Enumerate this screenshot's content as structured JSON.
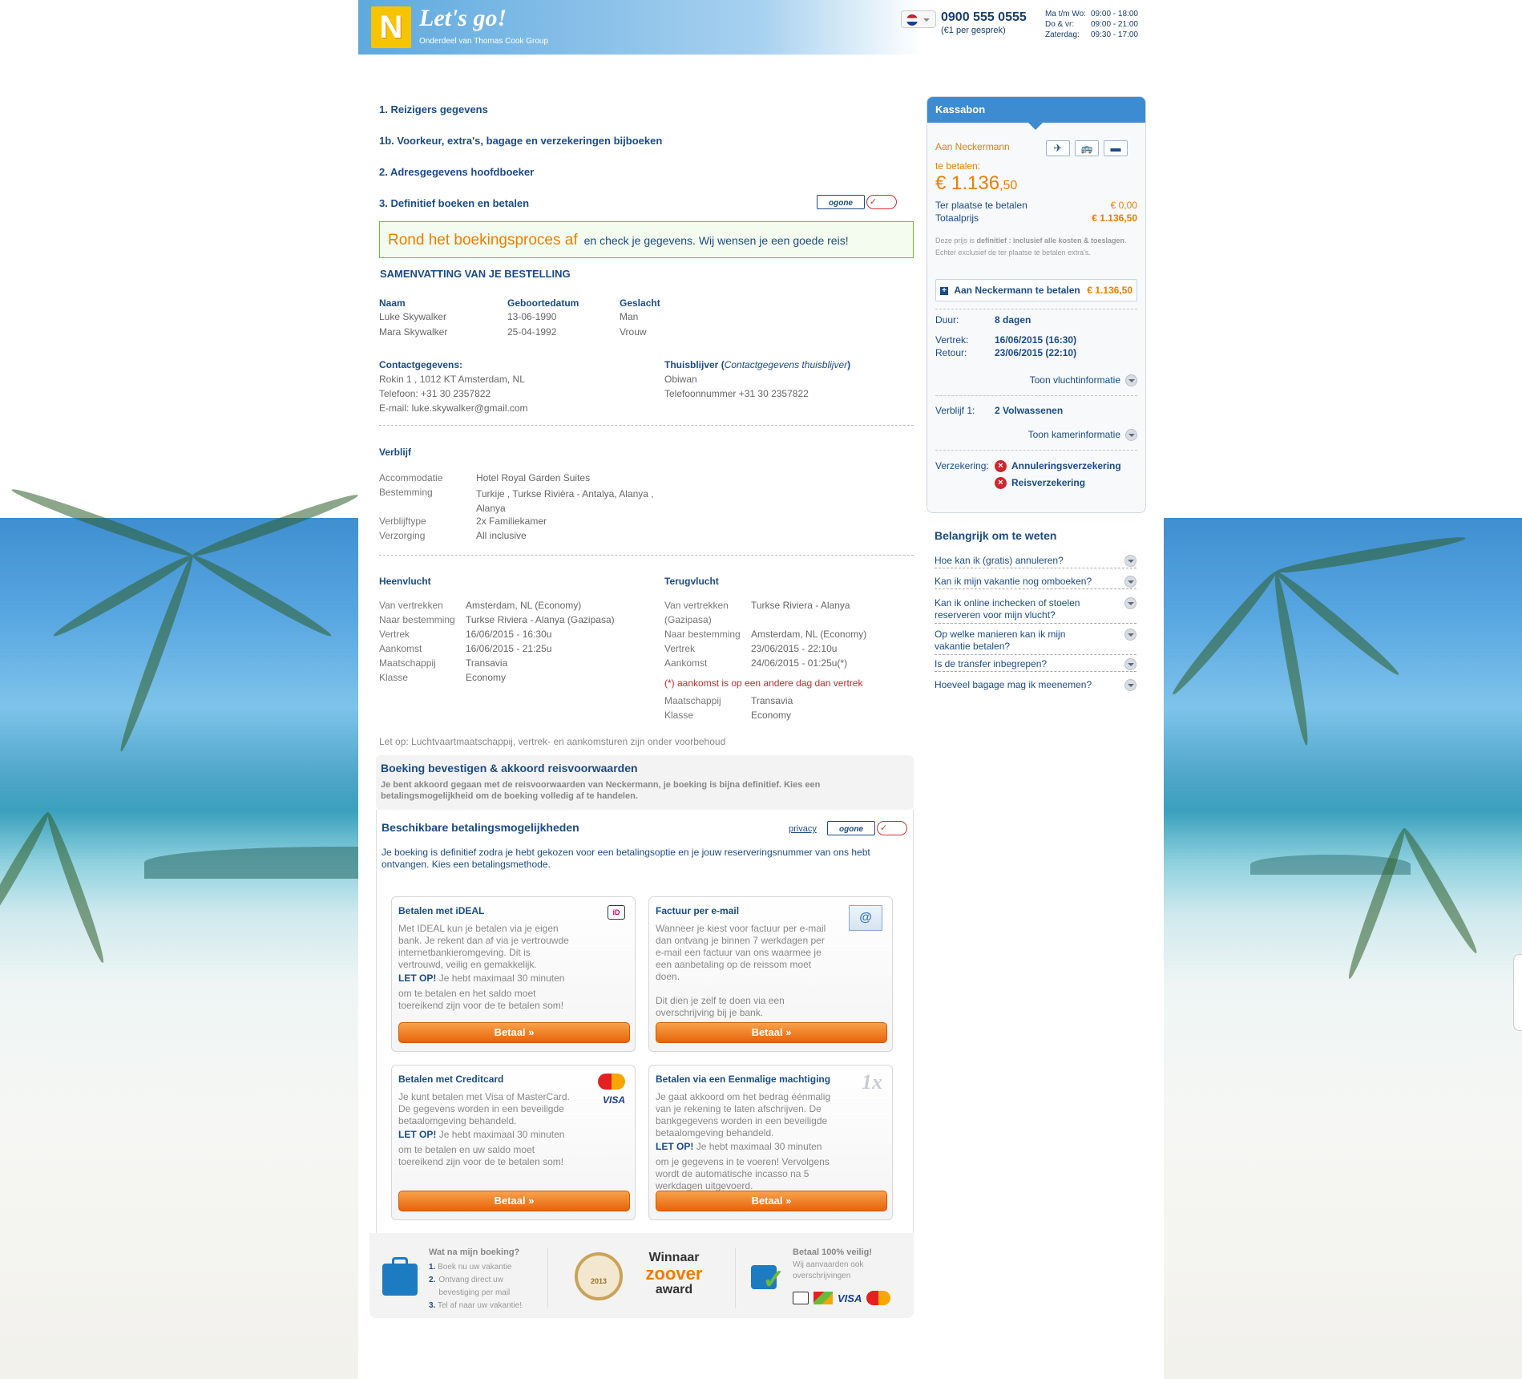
{
  "header": {
    "logo_brand": "Neckermann",
    "tagline": "Let's go!",
    "subtitle": "Onderdeel van Thomas Cook Group",
    "phone": "0900 555 0555",
    "phone_cost": "(€1 per gesprek)",
    "hours": [
      {
        "days": "Ma t/m Wo:",
        "time": "09:00 - 18:00"
      },
      {
        "days": "Do & vr:",
        "time": "09:00 - 21:00"
      },
      {
        "days": "Zaterdag:",
        "time": "09:30 - 17:00"
      }
    ]
  },
  "steps": [
    "1. Reizigers gegevens",
    "1b. Voorkeur, extra's, bagage en verzekeringen bijboeken",
    "2. Adresgegevens hoofdboeker",
    "3. Definitief boeken en betalen"
  ],
  "ogone_label": "ogone",
  "banner": {
    "big": "Rond het boekingsproces af",
    "small": "en check je gegevens. Wij wensen je een goede reis!"
  },
  "summary_title": "SAMENVATTING VAN JE BESTELLING",
  "travellers": {
    "headers": [
      "Naam",
      "Geboortedatum",
      "Geslacht"
    ],
    "rows": [
      [
        "Luke Skywalker",
        "13-06-1990",
        "Man"
      ],
      [
        "Mara Skywalker",
        "25-04-1992",
        "Vrouw"
      ]
    ]
  },
  "contact": {
    "title": "Contactgegevens:",
    "address": "Rokin 1 , 1012 KT Amsterdam, NL",
    "phone": "Telefoon: +31 30 2357822",
    "email": "E-mail: luke.skywalker@gmail.com"
  },
  "home": {
    "title": "Thuisblijver",
    "title_note": "Contactgegevens thuisblijver",
    "name": "Obiwan",
    "phone": "Telefoonnummer +31 30 2357822"
  },
  "stay": {
    "title": "Verblijf",
    "rows": [
      {
        "label": "Accommodatie",
        "value": "Hotel Royal Garden Suites"
      },
      {
        "label": "Bestemming",
        "value": "Turkije , Turkse Rivièra - Antalya, Alanya , Alanya"
      },
      {
        "label": "Verblijftype",
        "value": "2x Familiekamer"
      },
      {
        "label": "Verzorging",
        "value": "All inclusive"
      }
    ]
  },
  "outbound": {
    "title": "Heenvlucht",
    "rows": [
      {
        "label": "Van vertrekken",
        "value": "Amsterdam, NL (Economy)"
      },
      {
        "label": "Naar bestemming",
        "value": "Turkse Riviera - Alanya (Gazipasa)"
      },
      {
        "label": "Vertrek",
        "value": "16/06/2015 - 16:30u"
      },
      {
        "label": "Aankomst",
        "value": "16/06/2015 - 21:25u"
      },
      {
        "label": "Maatschappij",
        "value": "Transavia"
      },
      {
        "label": "Klasse",
        "value": "Economy"
      }
    ]
  },
  "return": {
    "title": "Terugvlucht",
    "rows": [
      {
        "label": "Van vertrekken",
        "value": "Turkse Riviera - Alanya"
      },
      {
        "label": "(Gazipasa)",
        "value": ""
      },
      {
        "label": "Naar bestemming",
        "value": "Amsterdam, NL (Economy)"
      },
      {
        "label": "Vertrek",
        "value": "23/06/2015 - 22:10u"
      },
      {
        "label": "Aankomst",
        "value": "24/06/2015 - 01:25u(*)"
      }
    ],
    "note": "(*) aankomst is op een andere dag dan vertrek",
    "rows2": [
      {
        "label": "Maatschappij",
        "value": "Transavia"
      },
      {
        "label": "Klasse",
        "value": "Economy"
      }
    ]
  },
  "flight_note": "Let op: Luchtvaartmaatschappij, vertrek- en aankomsturen zijn onder voorbehoud",
  "confirm": {
    "title": "Boeking bevestigen & akkoord reisvoorwaarden",
    "text": "Je bent akkoord gegaan met de reisvoorwaarden van Neckermann, je boeking is bijna definitief. Kies een betalingsmogelijkheid om de boeking volledig af te handelen."
  },
  "payment": {
    "title": "Beschikbare betalingsmogelijkheden",
    "privacy": "privacy",
    "intro": "Je boeking is definitief zodra je hebt gekozen voor een betalingsoptie en je jouw reserveringsnummer van ons hebt ontvangen. Kies een betalingsmethode.",
    "button": "Betaal »",
    "methods": [
      {
        "title": "Betalen met iDEAL",
        "text": "Met IDEAL kun je betalen via je eigen bank. Je rekent dan af via je vertrouwde internetbankieromgeving. Dit is vertrouwd, veilig en gemakkelijk.",
        "warn": "LET OP!",
        "warn_text": "Je hebt maximaal 30 minuten",
        "rest": "om te betalen en het saldo moet toereikend zijn voor de te betalen som!"
      },
      {
        "title": "Factuur per e-mail",
        "text": "Wanneer je kiest voor factuur per e-mail dan ontvang je binnen 7 werkdagen per e-mail een factuur van ons waarmee je een aanbetaling op de reissom moet doen.",
        "rest": "Dit dien je zelf te doen via een overschrijving bij je bank."
      },
      {
        "title": "Betalen met Creditcard",
        "text": "Je kunt betalen met Visa of MasterCard. De gegevens worden in een beveiligde betaalomgeving behandeld.",
        "warn": "LET OP!",
        "warn_text": "Je hebt maximaal 30 minuten",
        "rest": "om te betalen en uw saldo moet toereikend zijn voor de te betalen som!"
      },
      {
        "title": "Betalen via een Eenmalige machtiging",
        "text": "Je gaat akkoord om het bedrag éénmalig van je rekening te laten afschrijven. De bankgegevens worden in een beveiligde betaalomgeving behandeld.",
        "warn": "LET OP!",
        "warn_text": "Je hebt maximaal 30 minuten",
        "rest": "om je gegevens in te voeren! Vervolgens wordt de automatische incasso na 5 werkdagen uitgevoerd."
      }
    ]
  },
  "trust": {
    "after_title": "Wat na mijn boeking?",
    "after_steps": [
      "Boek nu uw vakantie",
      "Ontvang direct uw bevestiging per mail",
      "Tel af naar uw vakantie!"
    ],
    "award_line1": "Winnaar",
    "award_line2": "zoover",
    "award_line3": "award",
    "award_year": "2013",
    "safe_title": "Betaal 100% veilig!",
    "safe_text": "Wij aanvaarden ook overschrijvingen",
    "visa": "VISA"
  },
  "kassabon": {
    "title": "Kassabon",
    "to_neckermann": "Aan Neckermann",
    "to_pay": "te betalen:",
    "amount_main": "€ 1.136",
    "amount_cents": ",50",
    "onsite_label": "Ter plaatse te betalen",
    "onsite_value": "€ 0,00",
    "total_label": "Totaalprijs",
    "total_value": "€ 1.136,50",
    "disclaimer_a": "Deze prijs is ",
    "disclaimer_b": "definitief : inclusief alle kosten & toeslagen",
    "disclaimer_c": ". Echter exclusief de ter plaatse te betalen extra's.",
    "expand_label": "Aan Neckermann te betalen",
    "expand_value": "€ 1.136,50",
    "duur_label": "Duur:",
    "duur_value": "8 dagen",
    "vertrek_label": "Vertrek:",
    "vertrek_value": "16/06/2015 (16:30)",
    "retour_label": "Retour:",
    "retour_value": "23/06/2015 (22:10)",
    "flight_info": "Toon vluchtinformatie",
    "verblijf_label": "Verblijf 1:",
    "verblijf_value": "2 Volwassenen",
    "room_info": "Toon kamerinformatie",
    "ins_label": "Verzekering:",
    "ins_items": [
      "Annuleringsverzekering",
      "Reisverzekering"
    ]
  },
  "important": {
    "title": "Belangrijk om te weten",
    "items": [
      "Hoe kan ik (gratis) annuleren?",
      "Kan ik mijn vakantie nog omboeken?",
      "Kan ik online inchecken of stoelen reserveren voor mijn vlucht?",
      "Op welke manieren kan ik mijn vakantie betalen?",
      "Is de transfer inbegrepen?",
      "Hoeveel bagage mag ik meenemen?"
    ]
  }
}
